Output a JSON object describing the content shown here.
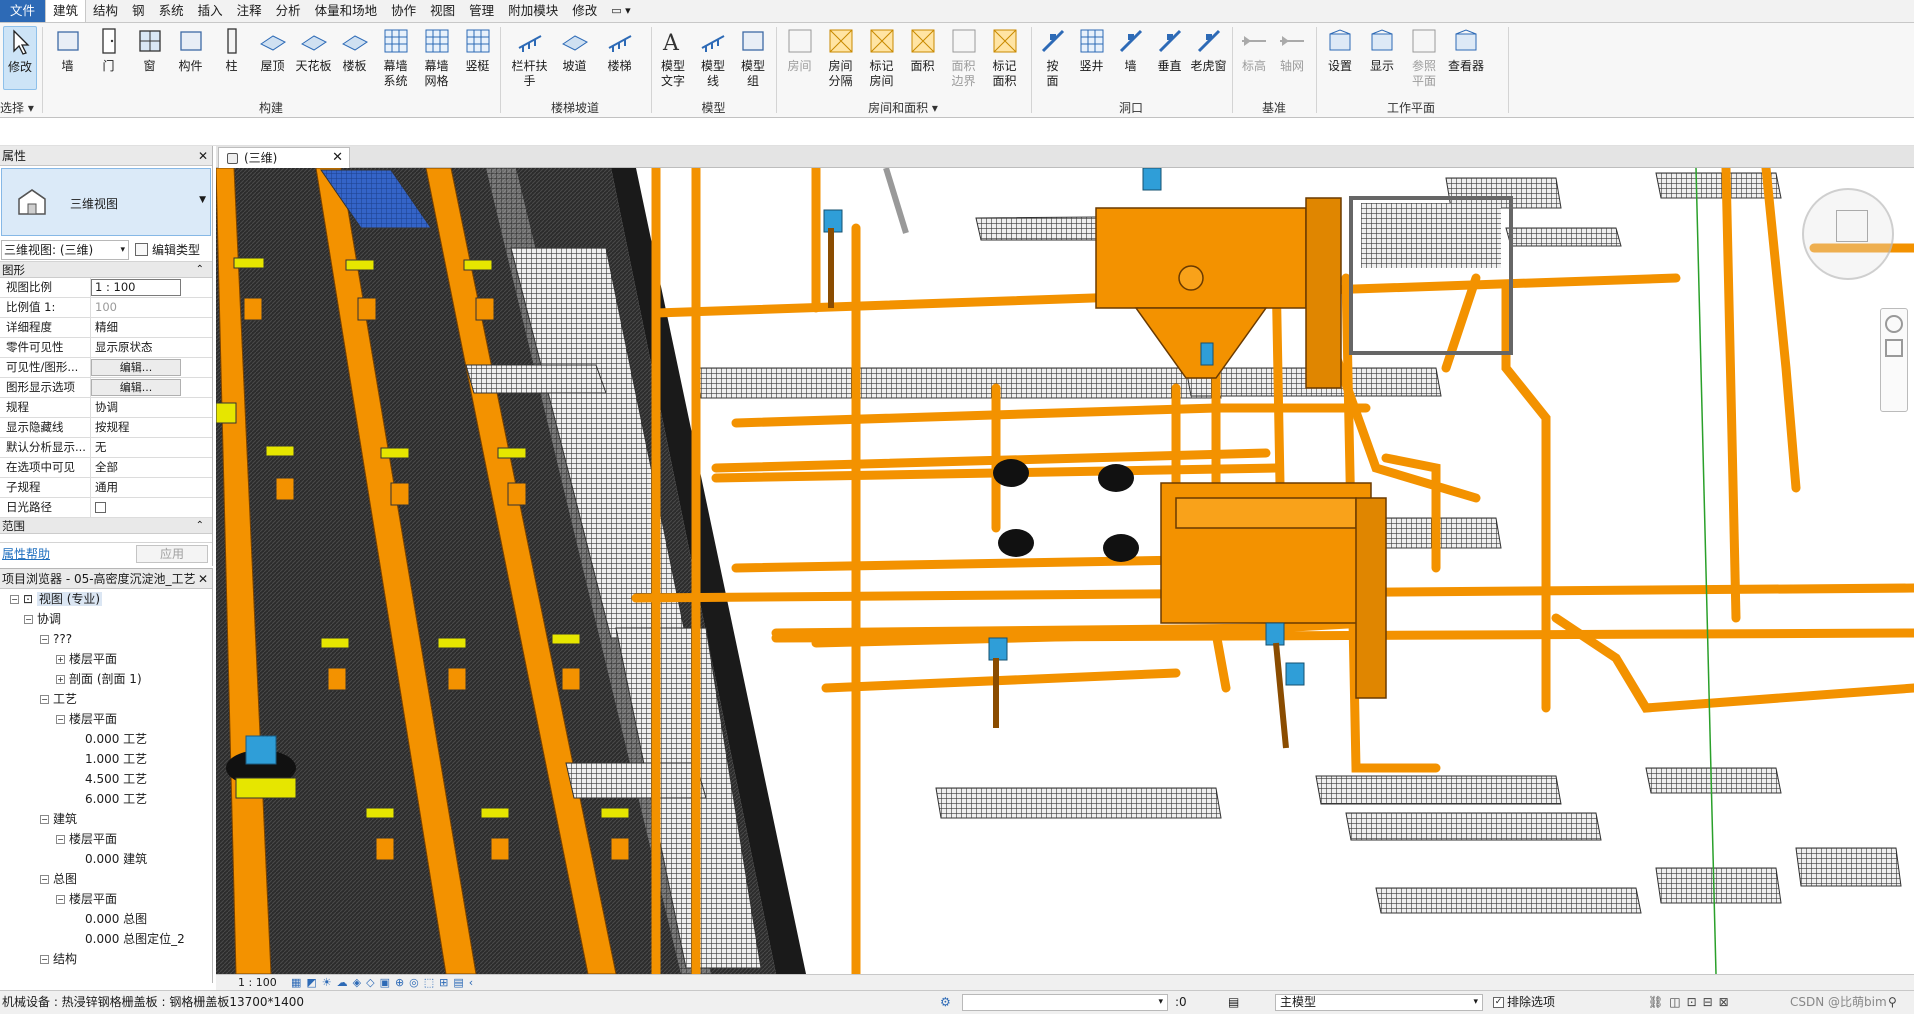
{
  "menu": {
    "tabs": [
      "文件",
      "建筑",
      "结构",
      "钢",
      "系统",
      "插入",
      "注释",
      "分析",
      "体量和场地",
      "协作",
      "视图",
      "管理",
      "附加模块",
      "修改"
    ],
    "active": "建筑",
    "extra": "▭ ▾"
  },
  "ribbon": {
    "select": {
      "modify": "修改",
      "select_label": "选择 ▾"
    },
    "build": {
      "label": "构建",
      "items": [
        "墙",
        "门",
        "窗",
        "构件",
        "柱",
        "屋顶",
        "天花板",
        "楼板",
        "幕墙\n系统",
        "幕墙\n网格",
        "竖梃"
      ]
    },
    "stairs": {
      "label": "楼梯坡道",
      "items": [
        "栏杆扶手",
        "坡道",
        "楼梯"
      ]
    },
    "model": {
      "label": "模型",
      "items": [
        "模型\n文字",
        "模型\n线",
        "模型\n组"
      ]
    },
    "rooms": {
      "label": "房间和面积 ▾",
      "items": [
        "房间",
        "房间\n分隔",
        "标记\n房间",
        "面积",
        "面积\n边界",
        "标记\n面积"
      ]
    },
    "opening": {
      "label": "洞口",
      "items": [
        "按\n面",
        "竖井",
        "墙",
        "垂直",
        "老虎窗"
      ]
    },
    "datum": {
      "label": "基准",
      "items": [
        "标高",
        "轴网"
      ]
    },
    "workplane": {
      "label": "工作平面",
      "items": [
        "设置",
        "显示",
        "参照\n平面",
        "查看器"
      ]
    }
  },
  "colors": {
    "accent": "#2d6ab6",
    "steel": "#f39200",
    "grating": "#3a3a3a",
    "water": "#2f9ed8",
    "tank": "#2c2c2c"
  },
  "view_tab": {
    "label": "(三维)",
    "close": "✕"
  },
  "properties": {
    "title": "属性",
    "type_name": "三维视图",
    "instance": "三维视图: (三维)",
    "edit_type": "编辑类型",
    "sections": {
      "graphics": "图形",
      "range": "范围"
    },
    "rows": [
      {
        "k": "视图比例",
        "v": "1 : 100"
      },
      {
        "k": "比例值 1:",
        "v": "100"
      },
      {
        "k": "详细程度",
        "v": "精细"
      },
      {
        "k": "零件可见性",
        "v": "显示原状态"
      },
      {
        "k": "可见性/图形...",
        "v": "编辑..."
      },
      {
        "k": "图形显示选项",
        "v": "编辑..."
      },
      {
        "k": "规程",
        "v": "协调"
      },
      {
        "k": "显示隐藏线",
        "v": "按规程"
      },
      {
        "k": "默认分析显示...",
        "v": "无"
      },
      {
        "k": "在选项中可见",
        "v": "全部"
      },
      {
        "k": "子规程",
        "v": "通用"
      },
      {
        "k": "日光路径",
        "v": ""
      }
    ],
    "help": "属性帮助",
    "apply": "应用"
  },
  "browser": {
    "title": "项目浏览器 - 05-高密度沉淀池_工艺",
    "items": [
      "视图 (专业)",
      "协调",
      "???",
      "楼层平面",
      "剖面 (剖面 1)",
      "工艺",
      "楼层平面",
      "0.000 工艺",
      "1.000 工艺",
      "4.500 工艺",
      "6.000 工艺",
      "建筑",
      "楼层平面",
      "0.000 建筑",
      "总图",
      "楼层平面",
      "0.000 总图",
      "0.000 总图定位_2",
      "结构"
    ]
  },
  "view_bar": {
    "scale": "1 : 100"
  },
  "status": {
    "text": "机械设备 : 热浸锌钢格栅盖板 : 钢格栅盖板13700*1400",
    "workset": ":0",
    "model": "主模型",
    "exclude": "排除选项",
    "watermark": "CSDN @比萌bim"
  }
}
